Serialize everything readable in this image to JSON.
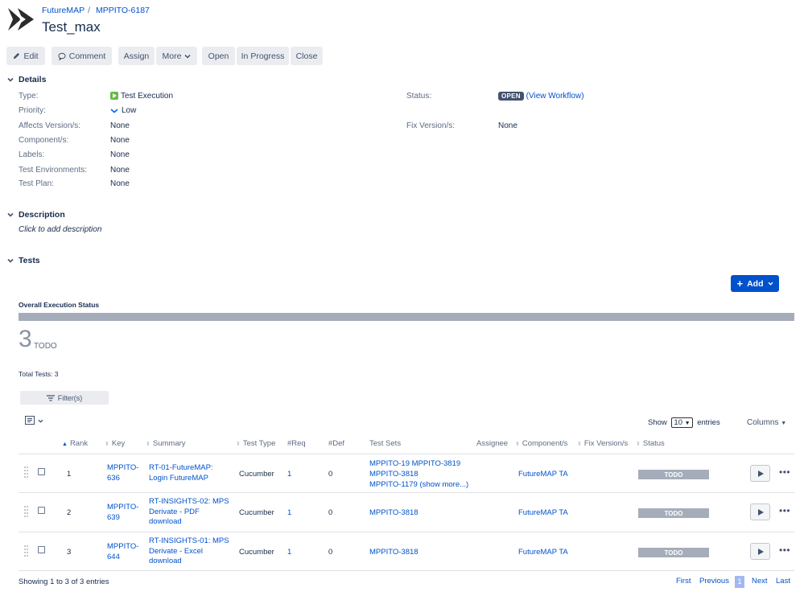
{
  "breadcrumb": {
    "project": "FutureMAP",
    "issue_key": "MPPITO-6187"
  },
  "title": "Test_max",
  "toolbar": {
    "edit": "Edit",
    "comment": "Comment",
    "assign": "Assign",
    "more": "More",
    "open": "Open",
    "in_progress": "In Progress",
    "close": "Close"
  },
  "details": {
    "heading": "Details",
    "type_label": "Type:",
    "type_value": "Test Execution",
    "priority_label": "Priority:",
    "priority_value": "Low",
    "affects_label": "Affects Version/s:",
    "affects_value": "None",
    "components_label": "Component/s:",
    "components_value": "None",
    "labels_label": "Labels:",
    "labels_value": "None",
    "envs_label": "Test Environments:",
    "envs_value": "None",
    "plan_label": "Test Plan:",
    "plan_value": "None",
    "status_label": "Status:",
    "status_value": "OPEN",
    "view_workflow": "(View Workflow)",
    "fix_label": "Fix Version/s:",
    "fix_value": "None"
  },
  "description": {
    "heading": "Description",
    "placeholder": "Click to add description"
  },
  "tests": {
    "heading": "Tests",
    "add_button": "Add",
    "overall_label": "Overall Execution Status",
    "count": "3",
    "count_status": "TODO",
    "total": "Total Tests: 3",
    "filter_button": "Filter(s)",
    "show_label": "Show",
    "show_value": "10",
    "entries_label": "entries",
    "columns_button": "Columns",
    "headers": {
      "rank": "Rank",
      "key": "Key",
      "summary": "Summary",
      "test_type": "Test Type",
      "req": "#Req",
      "def": "#Def",
      "test_sets": "Test Sets",
      "assignee": "Assignee",
      "components": "Component/s",
      "fix_versions": "Fix Version/s",
      "status": "Status"
    },
    "rows": [
      {
        "rank": "1",
        "key": "MPPITO-636",
        "summary": "RT-01-FutureMAP: Login FutureMAP",
        "test_type": "Cucumber",
        "req": "1",
        "def": "0",
        "test_sets_1": "MPPITO-19 MPPITO-3819",
        "test_sets_2": "MPPITO-3818",
        "test_sets_3": "MPPITO-1179",
        "show_more": "(show more...)",
        "component": "FutureMAP TA",
        "status": "TODO"
      },
      {
        "rank": "2",
        "key": "MPPITO-639",
        "summary": "RT-INSIGHTS-02: MPS Derivate - PDF download",
        "test_type": "Cucumber",
        "req": "1",
        "def": "0",
        "test_sets_1": "MPPITO-3818",
        "component": "FutureMAP TA",
        "status": "TODO"
      },
      {
        "rank": "3",
        "key": "MPPITO-644",
        "summary": "RT-INSIGHTS-01: MPS Derivate - Excel download",
        "test_type": "Cucumber",
        "req": "1",
        "def": "0",
        "test_sets_1": "MPPITO-3818",
        "component": "FutureMAP TA",
        "status": "TODO"
      }
    ],
    "footer": "Showing 1 to 3 of 3 entries",
    "pager": {
      "first": "First",
      "previous": "Previous",
      "current": "1",
      "next": "Next",
      "last": "Last"
    }
  },
  "colors": {
    "link": "#0052cc",
    "primary_button": "#0052cc",
    "todo": "#a5adba",
    "type_icon": "#65ba43"
  }
}
